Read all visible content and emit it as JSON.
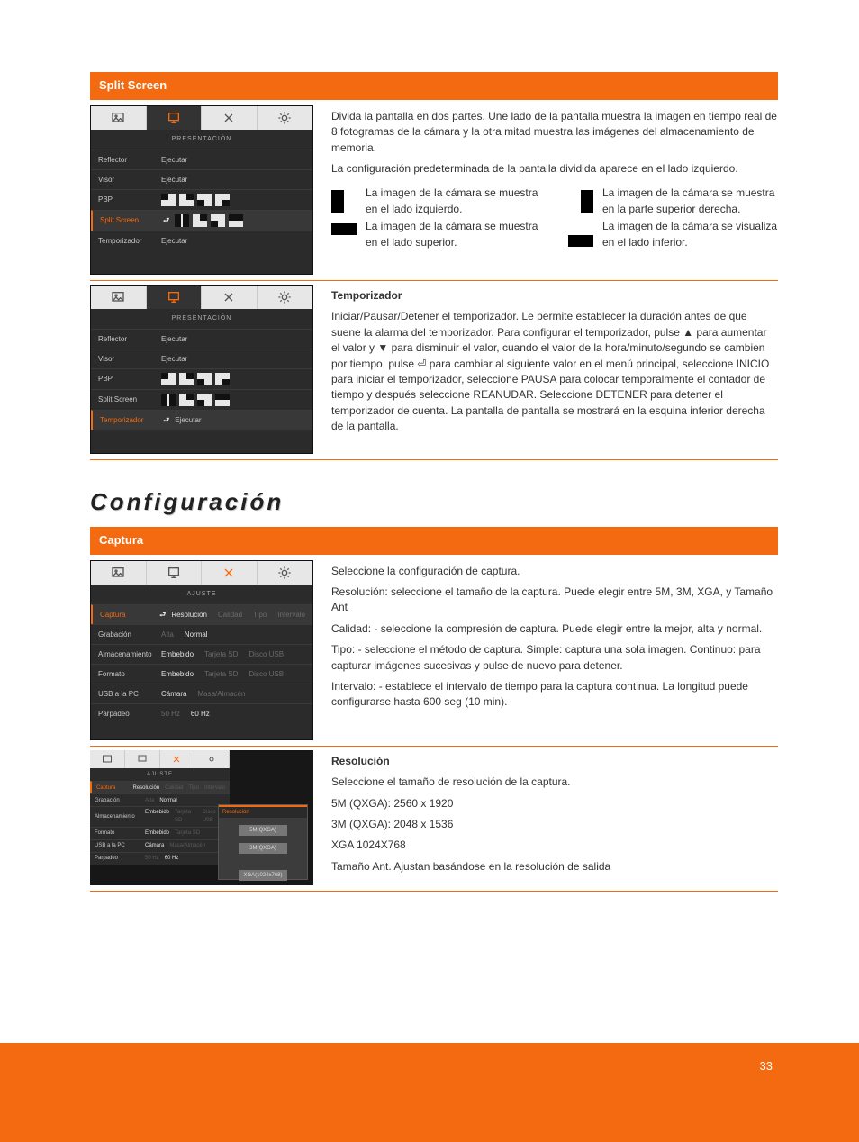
{
  "sections": {
    "split_bar": "Split Screen",
    "split_desc": "Divida la pantalla en dos partes. Une lado de la pantalla muestra la imagen en tiempo real de 8 fotogramas de la cámara y la otra mitad muestra las imágenes del almacenamiento de memoria.",
    "split_default": "La configuración predeterminada de la pantalla dividida aparece en el lado izquierdo.",
    "split_opts": {
      "left": "La imagen de la cámara se muestra en el lado izquierdo.",
      "right": "La imagen de la cámara se muestra en la parte superior derecha.",
      "up": "La imagen de la cámara se muestra en el lado superior.",
      "down": "La imagen de la cámara se visualiza en el lado inferior."
    },
    "timer_label": "Temporizador",
    "timer_desc": "Iniciar/Pausar/Detener el temporizador. Le permite establecer la duración antes de que suene la alarma del temporizador. Para configurar el temporizador, pulse ▲ para aumentar el valor y ▼ para disminuir el valor, cuando el valor de la hora/minuto/segundo se cambien por tiempo, pulse ⏎ para cambiar al siguiente valor en el menú principal, seleccione INICIO para iniciar el temporizador, seleccione PAUSA para colocar temporalmente el contador de tiempo y después seleccione REANUDAR. Seleccione DETENER para detener el temporizador de cuenta. La pantalla de pantalla se mostrará en la esquina inferior derecha de la pantalla.",
    "config_heading": "Configuración",
    "capture_bar": "Captura",
    "capture_desc": {
      "lead": "Seleccione la configuración de captura.",
      "res": "Resolución: seleccione el tamaño de la captura. Puede elegir entre 5M, 3M, XGA, y Tamaño Ant",
      "q": "Calidad: - seleccione la compresión de captura. Puede elegir entre la mejor, alta y normal.",
      "t": "Tipo: - seleccione el método de captura. Simple: captura una sola imagen. Continuo: para capturar imágenes sucesivas y pulse de nuevo para detener.",
      "i": "Intervalo: - establece el intervalo de tiempo para la captura continua. La longitud puede configurarse hasta 600 seg (10 min)."
    },
    "res_label": "Resolución",
    "res_desc": {
      "lead": "Seleccione el tamaño de resolución de la captura.",
      "a": "5M (QXGA): 2560 x 1920",
      "b": "3M (QXGA): 2048 x 1536",
      "c": "XGA 1024X768",
      "d": "Tamaño Ant. Ajustan basándose en la resolución de salida"
    }
  },
  "ui": {
    "present_title": "PRESENTACIÓN",
    "ajuste_title": "AJUSTE",
    "rows_present": {
      "reflector": "Reflector",
      "visor": "Visor",
      "pbp": "PBP",
      "split": "Split Screen",
      "temporizador": "Temporizador",
      "ejecutar": "Ejecutar"
    },
    "rows_ajuste": {
      "captura": "Captura",
      "grabacion": "Grabación",
      "almacen": "Almacenamiento",
      "formato": "Formato",
      "usbpc": "USB a la PC",
      "parpadeo": "Parpadeo",
      "resolucion": "Resolución",
      "calidad": "Calidad",
      "tipo": "Tipo",
      "intervalo": "Intervalo",
      "alta": "Alta",
      "normal": "Normal",
      "embebido": "Embebido",
      "tarjeta": "Tarjeta SD",
      "disco": "Disco USB",
      "camara": "Cámara",
      "masa": "Masa/Almacén",
      "hz50": "50 Hz",
      "hz60": "60 Hz"
    },
    "popup": {
      "title": "Resolución",
      "o1": "5M(QXGA)",
      "o2": "3M(QXGA)",
      "o3": "XGA(1024x768)"
    }
  },
  "footer": {
    "page": "33"
  }
}
